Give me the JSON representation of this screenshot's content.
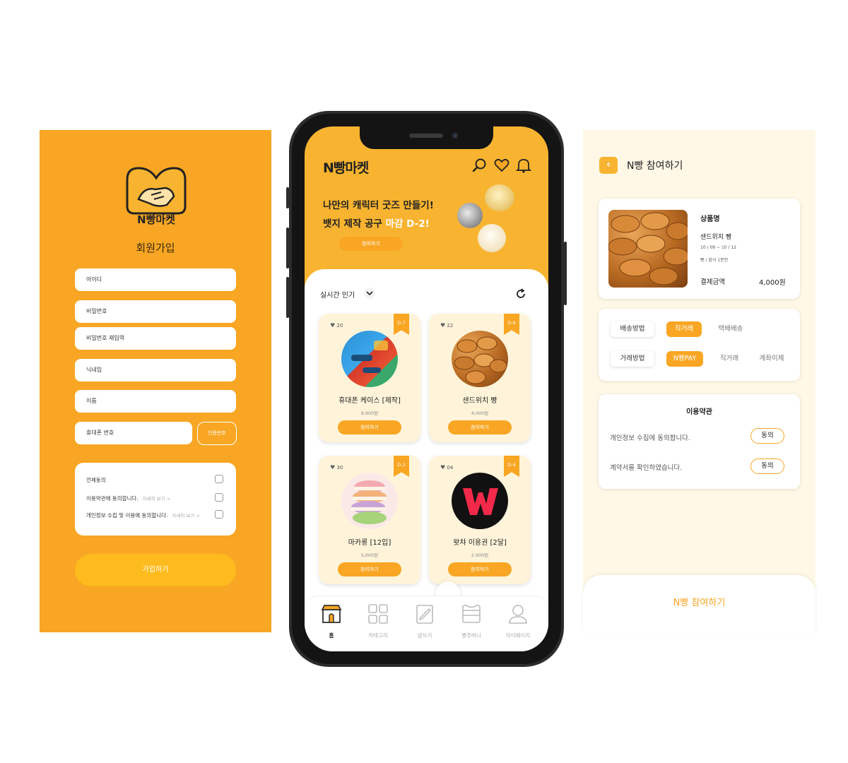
{
  "colors": {
    "accent": "#F8A623",
    "accent_light": "#FFF8E7",
    "card_bg": "#FFF4DA",
    "text": "#222222"
  },
  "signup": {
    "logo_text": "N빵마켓",
    "title": "회원가입",
    "fields": {
      "id": "아이디",
      "password": "비밀번호",
      "password_confirm": "비밀번호 재입력",
      "nickname": "닉네임",
      "name": "이름",
      "phone": "휴대폰 번호"
    },
    "verify_label": "인증번호",
    "agree_all": "전체동의",
    "agree_terms": "이용약관에 동의합니다.",
    "agree_privacy": "개인정보 수집 및 이용에 동의합니다.",
    "more": "자세히 보기 >",
    "submit": "가입하기"
  },
  "home": {
    "app_title": "N빵마켓",
    "icons": [
      "search-icon",
      "heart-icon",
      "bell-icon"
    ],
    "promo_line1": "나만의 캐릭터 굿즈 만들기!",
    "promo_line2_prefix": "뱃지 제작 공구 ",
    "promo_line2_highlight": "마감 D-2!",
    "promo_button": "참여하기",
    "section_title": "실시간 인기",
    "products": [
      {
        "likes": "20",
        "dday": "D-7",
        "name": "휴대폰 케이스 [제작]",
        "price": "9,900원",
        "button": "참여하기"
      },
      {
        "likes": "22",
        "dday": "D-9",
        "name": "샌드위치 빵",
        "price": "4,000원",
        "button": "참여하기"
      },
      {
        "likes": "30",
        "dday": "D-2",
        "name": "마카롱 [12입]",
        "price": "5,000원",
        "button": "참여하기"
      },
      {
        "likes": "04",
        "dday": "D-4",
        "name": "왓챠 이용권 [2달]",
        "price": "2,900원",
        "button": "참여하기"
      }
    ],
    "tabs": [
      "홈",
      "카테고리",
      "글쓰기",
      "빵주머니",
      "마이페이지"
    ]
  },
  "detail": {
    "title": "N빵 참여하기",
    "product_label": "상품명",
    "product_name": "샌드위치 빵",
    "date_range": "10 / 09 ~ 10 / 12",
    "category": "빵 / 음식 1분전",
    "pay_label": "결제금액",
    "pay_amount": "4,000원",
    "delivery_label": "배송방법",
    "delivery_options": [
      "직거래",
      "택배배송"
    ],
    "trade_label": "거래방법",
    "trade_options": [
      "N빵PAY",
      "직거래",
      "계좌이체"
    ],
    "terms_title": "이용약관",
    "terms_privacy": "개인정보 수집에 동의합니다.",
    "terms_contract": "계약서를 확인하였습니다.",
    "agree_button": "동의",
    "cta": "N빵 참여하기"
  }
}
